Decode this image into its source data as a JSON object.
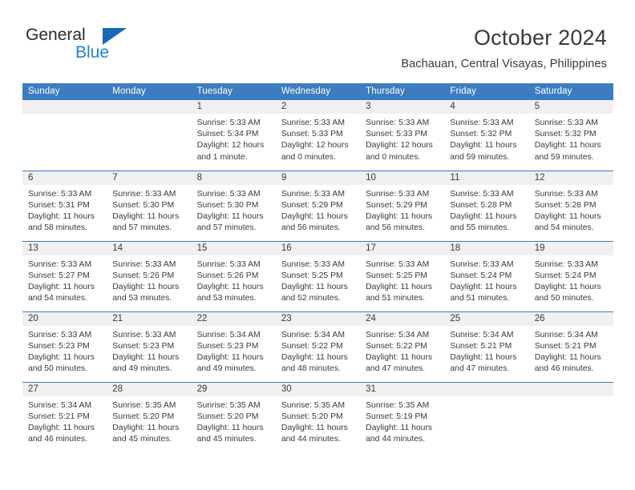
{
  "brand": {
    "name_top": "General",
    "name_bottom": "Blue",
    "triangle_color": "#1668b3",
    "blue_color": "#1b84d6",
    "dark_color": "#2b2b2b"
  },
  "header": {
    "title": "October 2024",
    "subtitle": "Bachauan, Central Visayas, Philippines"
  },
  "theme": {
    "header_blue": "#3c7cbf",
    "daynum_band": "#f0f0f0",
    "text": "#3a3a3a"
  },
  "weekdays": [
    "Sunday",
    "Monday",
    "Tuesday",
    "Wednesday",
    "Thursday",
    "Friday",
    "Saturday"
  ],
  "weeks": [
    [
      {
        "day": "",
        "sunrise": "",
        "sunset": "",
        "daylight1": "",
        "daylight2": ""
      },
      {
        "day": "",
        "sunrise": "",
        "sunset": "",
        "daylight1": "",
        "daylight2": ""
      },
      {
        "day": "1",
        "sunrise": "Sunrise: 5:33 AM",
        "sunset": "Sunset: 5:34 PM",
        "daylight1": "Daylight: 12 hours",
        "daylight2": "and 1 minute."
      },
      {
        "day": "2",
        "sunrise": "Sunrise: 5:33 AM",
        "sunset": "Sunset: 5:33 PM",
        "daylight1": "Daylight: 12 hours",
        "daylight2": "and 0 minutes."
      },
      {
        "day": "3",
        "sunrise": "Sunrise: 5:33 AM",
        "sunset": "Sunset: 5:33 PM",
        "daylight1": "Daylight: 12 hours",
        "daylight2": "and 0 minutes."
      },
      {
        "day": "4",
        "sunrise": "Sunrise: 5:33 AM",
        "sunset": "Sunset: 5:32 PM",
        "daylight1": "Daylight: 11 hours",
        "daylight2": "and 59 minutes."
      },
      {
        "day": "5",
        "sunrise": "Sunrise: 5:33 AM",
        "sunset": "Sunset: 5:32 PM",
        "daylight1": "Daylight: 11 hours",
        "daylight2": "and 59 minutes."
      }
    ],
    [
      {
        "day": "6",
        "sunrise": "Sunrise: 5:33 AM",
        "sunset": "Sunset: 5:31 PM",
        "daylight1": "Daylight: 11 hours",
        "daylight2": "and 58 minutes."
      },
      {
        "day": "7",
        "sunrise": "Sunrise: 5:33 AM",
        "sunset": "Sunset: 5:30 PM",
        "daylight1": "Daylight: 11 hours",
        "daylight2": "and 57 minutes."
      },
      {
        "day": "8",
        "sunrise": "Sunrise: 5:33 AM",
        "sunset": "Sunset: 5:30 PM",
        "daylight1": "Daylight: 11 hours",
        "daylight2": "and 57 minutes."
      },
      {
        "day": "9",
        "sunrise": "Sunrise: 5:33 AM",
        "sunset": "Sunset: 5:29 PM",
        "daylight1": "Daylight: 11 hours",
        "daylight2": "and 56 minutes."
      },
      {
        "day": "10",
        "sunrise": "Sunrise: 5:33 AM",
        "sunset": "Sunset: 5:29 PM",
        "daylight1": "Daylight: 11 hours",
        "daylight2": "and 56 minutes."
      },
      {
        "day": "11",
        "sunrise": "Sunrise: 5:33 AM",
        "sunset": "Sunset: 5:28 PM",
        "daylight1": "Daylight: 11 hours",
        "daylight2": "and 55 minutes."
      },
      {
        "day": "12",
        "sunrise": "Sunrise: 5:33 AM",
        "sunset": "Sunset: 5:28 PM",
        "daylight1": "Daylight: 11 hours",
        "daylight2": "and 54 minutes."
      }
    ],
    [
      {
        "day": "13",
        "sunrise": "Sunrise: 5:33 AM",
        "sunset": "Sunset: 5:27 PM",
        "daylight1": "Daylight: 11 hours",
        "daylight2": "and 54 minutes."
      },
      {
        "day": "14",
        "sunrise": "Sunrise: 5:33 AM",
        "sunset": "Sunset: 5:26 PM",
        "daylight1": "Daylight: 11 hours",
        "daylight2": "and 53 minutes."
      },
      {
        "day": "15",
        "sunrise": "Sunrise: 5:33 AM",
        "sunset": "Sunset: 5:26 PM",
        "daylight1": "Daylight: 11 hours",
        "daylight2": "and 53 minutes."
      },
      {
        "day": "16",
        "sunrise": "Sunrise: 5:33 AM",
        "sunset": "Sunset: 5:25 PM",
        "daylight1": "Daylight: 11 hours",
        "daylight2": "and 52 minutes."
      },
      {
        "day": "17",
        "sunrise": "Sunrise: 5:33 AM",
        "sunset": "Sunset: 5:25 PM",
        "daylight1": "Daylight: 11 hours",
        "daylight2": "and 51 minutes."
      },
      {
        "day": "18",
        "sunrise": "Sunrise: 5:33 AM",
        "sunset": "Sunset: 5:24 PM",
        "daylight1": "Daylight: 11 hours",
        "daylight2": "and 51 minutes."
      },
      {
        "day": "19",
        "sunrise": "Sunrise: 5:33 AM",
        "sunset": "Sunset: 5:24 PM",
        "daylight1": "Daylight: 11 hours",
        "daylight2": "and 50 minutes."
      }
    ],
    [
      {
        "day": "20",
        "sunrise": "Sunrise: 5:33 AM",
        "sunset": "Sunset: 5:23 PM",
        "daylight1": "Daylight: 11 hours",
        "daylight2": "and 50 minutes."
      },
      {
        "day": "21",
        "sunrise": "Sunrise: 5:33 AM",
        "sunset": "Sunset: 5:23 PM",
        "daylight1": "Daylight: 11 hours",
        "daylight2": "and 49 minutes."
      },
      {
        "day": "22",
        "sunrise": "Sunrise: 5:34 AM",
        "sunset": "Sunset: 5:23 PM",
        "daylight1": "Daylight: 11 hours",
        "daylight2": "and 49 minutes."
      },
      {
        "day": "23",
        "sunrise": "Sunrise: 5:34 AM",
        "sunset": "Sunset: 5:22 PM",
        "daylight1": "Daylight: 11 hours",
        "daylight2": "and 48 minutes."
      },
      {
        "day": "24",
        "sunrise": "Sunrise: 5:34 AM",
        "sunset": "Sunset: 5:22 PM",
        "daylight1": "Daylight: 11 hours",
        "daylight2": "and 47 minutes."
      },
      {
        "day": "25",
        "sunrise": "Sunrise: 5:34 AM",
        "sunset": "Sunset: 5:21 PM",
        "daylight1": "Daylight: 11 hours",
        "daylight2": "and 47 minutes."
      },
      {
        "day": "26",
        "sunrise": "Sunrise: 5:34 AM",
        "sunset": "Sunset: 5:21 PM",
        "daylight1": "Daylight: 11 hours",
        "daylight2": "and 46 minutes."
      }
    ],
    [
      {
        "day": "27",
        "sunrise": "Sunrise: 5:34 AM",
        "sunset": "Sunset: 5:21 PM",
        "daylight1": "Daylight: 11 hours",
        "daylight2": "and 46 minutes."
      },
      {
        "day": "28",
        "sunrise": "Sunrise: 5:35 AM",
        "sunset": "Sunset: 5:20 PM",
        "daylight1": "Daylight: 11 hours",
        "daylight2": "and 45 minutes."
      },
      {
        "day": "29",
        "sunrise": "Sunrise: 5:35 AM",
        "sunset": "Sunset: 5:20 PM",
        "daylight1": "Daylight: 11 hours",
        "daylight2": "and 45 minutes."
      },
      {
        "day": "30",
        "sunrise": "Sunrise: 5:35 AM",
        "sunset": "Sunset: 5:20 PM",
        "daylight1": "Daylight: 11 hours",
        "daylight2": "and 44 minutes."
      },
      {
        "day": "31",
        "sunrise": "Sunrise: 5:35 AM",
        "sunset": "Sunset: 5:19 PM",
        "daylight1": "Daylight: 11 hours",
        "daylight2": "and 44 minutes."
      },
      {
        "day": "",
        "sunrise": "",
        "sunset": "",
        "daylight1": "",
        "daylight2": ""
      },
      {
        "day": "",
        "sunrise": "",
        "sunset": "",
        "daylight1": "",
        "daylight2": ""
      }
    ]
  ]
}
